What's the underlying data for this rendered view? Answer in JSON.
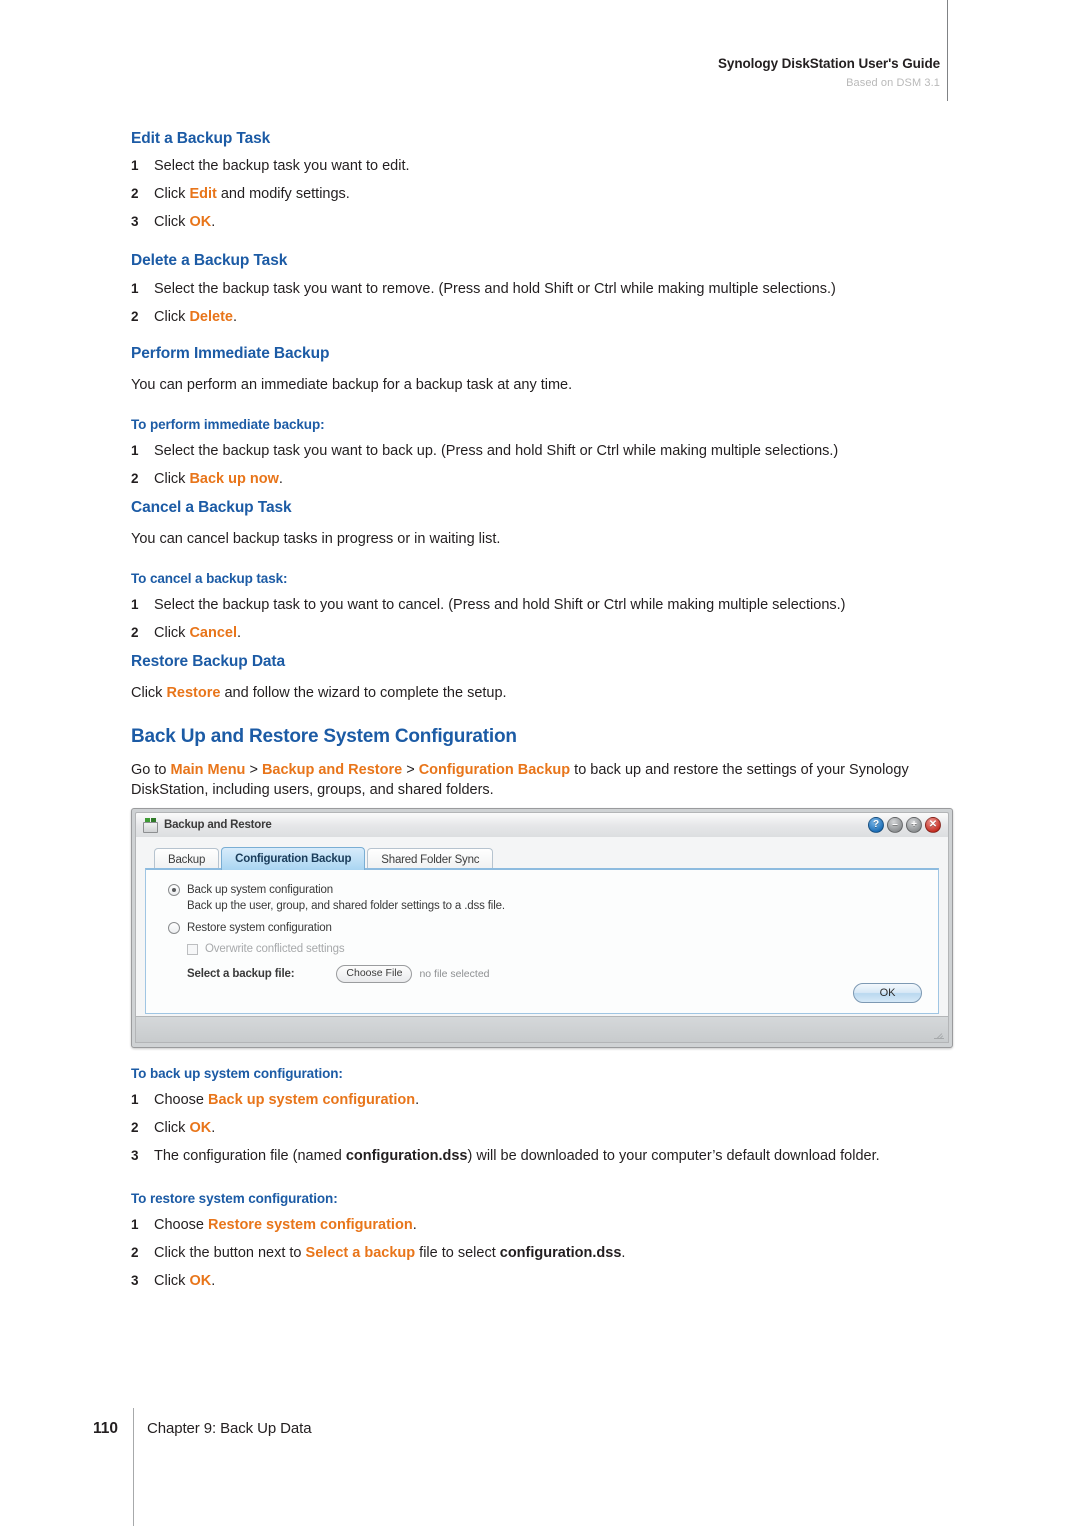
{
  "header": {
    "title": "Synology DiskStation User's Guide",
    "subtitle": "Based on DSM 3.1"
  },
  "sections": [
    {
      "id": "edit-backup-task",
      "heading": "Edit a Backup Task",
      "steps": [
        {
          "num": "1",
          "parts": [
            {
              "t": "Select the backup task you want to edit.",
              "s": "plain"
            }
          ]
        },
        {
          "num": "2",
          "parts": [
            {
              "t": "Click ",
              "s": "plain"
            },
            {
              "t": "Edit",
              "s": "em"
            },
            {
              "t": " and modify settings.",
              "s": "plain"
            }
          ]
        },
        {
          "num": "3",
          "parts": [
            {
              "t": "Click ",
              "s": "plain"
            },
            {
              "t": "OK",
              "s": "em"
            },
            {
              "t": ".",
              "s": "plain"
            }
          ]
        }
      ]
    },
    {
      "id": "delete-backup-task",
      "heading": "Delete a Backup Task",
      "steps": [
        {
          "num": "1",
          "parts": [
            {
              "t": "Select the backup task you want to remove. (Press and hold Shift or Ctrl while making multiple selections.)",
              "s": "plain"
            }
          ]
        },
        {
          "num": "2",
          "parts": [
            {
              "t": "Click ",
              "s": "plain"
            },
            {
              "t": "Delete",
              "s": "em"
            },
            {
              "t": ".",
              "s": "plain"
            }
          ]
        }
      ]
    },
    {
      "id": "perform-immediate-backup",
      "heading": "Perform Immediate Backup",
      "intro": "You can perform an immediate backup for a backup task at any time.",
      "subheading": "To perform immediate backup:",
      "steps": [
        {
          "num": "1",
          "parts": [
            {
              "t": "Select the backup task you want to back up. (Press and hold Shift or Ctrl while making multiple selections.)",
              "s": "plain"
            }
          ]
        },
        {
          "num": "2",
          "parts": [
            {
              "t": "Click ",
              "s": "plain"
            },
            {
              "t": "Back up now",
              "s": "em"
            },
            {
              "t": ".",
              "s": "plain"
            }
          ]
        }
      ]
    },
    {
      "id": "cancel-backup-task",
      "heading": "Cancel a Backup Task",
      "intro": "You can cancel backup tasks in progress or in waiting list.",
      "subheading": "To cancel a backup task:",
      "steps": [
        {
          "num": "1",
          "parts": [
            {
              "t": "Select the backup task to you want to cancel. (Press and hold Shift or Ctrl while making multiple selections.)",
              "s": "plain"
            }
          ]
        },
        {
          "num": "2",
          "parts": [
            {
              "t": "Click ",
              "s": "plain"
            },
            {
              "t": "Cancel",
              "s": "em"
            },
            {
              "t": ".",
              "s": "plain"
            }
          ]
        }
      ]
    },
    {
      "id": "restore-backup-data",
      "heading": "Restore Backup Data",
      "body": [
        {
          "t": "Click ",
          "s": "plain"
        },
        {
          "t": "Restore",
          "s": "em"
        },
        {
          "t": " and follow the wizard to complete the setup.",
          "s": "plain"
        }
      ]
    }
  ],
  "main_section": {
    "heading": "Back Up and Restore System Configuration",
    "intro": [
      {
        "t": "Go to ",
        "s": "plain"
      },
      {
        "t": "Main Menu",
        "s": "em"
      },
      {
        "t": " > ",
        "s": "plain"
      },
      {
        "t": "Backup and Restore",
        "s": "em"
      },
      {
        "t": " > ",
        "s": "plain"
      },
      {
        "t": "Configuration Backup",
        "s": "em"
      },
      {
        "t": " to back up and restore the settings of your Synology DiskStation, including users, groups, and shared folders.",
        "s": "plain"
      }
    ]
  },
  "app_window": {
    "title": "Backup and Restore",
    "window_buttons": [
      {
        "name": "help-button",
        "glyph": "?"
      },
      {
        "name": "minimize-button",
        "glyph": "–"
      },
      {
        "name": "maximize-button",
        "glyph": "+"
      },
      {
        "name": "close-button",
        "glyph": "✕"
      }
    ],
    "tabs": [
      {
        "label": "Backup",
        "active": false
      },
      {
        "label": "Configuration Backup",
        "active": true
      },
      {
        "label": "Shared Folder Sync",
        "active": false
      }
    ],
    "form": {
      "backup_radio_label": "Back up system configuration",
      "backup_radio_selected": true,
      "backup_description": "Back up the user, group, and shared folder settings to a .dss file.",
      "restore_radio_label": "Restore system configuration",
      "restore_radio_selected": false,
      "overwrite_checkbox_label": "Overwrite conflicted settings",
      "overwrite_checked": false,
      "select_file_label": "Select a backup file:",
      "choose_file_button": "Choose File",
      "file_status": "no file selected",
      "ok_button": "OK"
    }
  },
  "post_sections": [
    {
      "id": "to-back-up-system-configuration",
      "subheading": "To back up system configuration:",
      "steps": [
        {
          "num": "1",
          "parts": [
            {
              "t": "Choose ",
              "s": "plain"
            },
            {
              "t": "Back up system configuration",
              "s": "em"
            },
            {
              "t": ".",
              "s": "plain"
            }
          ]
        },
        {
          "num": "2",
          "parts": [
            {
              "t": "Click ",
              "s": "plain"
            },
            {
              "t": "OK",
              "s": "em"
            },
            {
              "t": ".",
              "s": "plain"
            }
          ]
        },
        {
          "num": "3",
          "parts": [
            {
              "t": "The configuration file (named ",
              "s": "plain"
            },
            {
              "t": "configuration.dss",
              "s": "bold"
            },
            {
              "t": ") will be downloaded to your computer’s default download folder.",
              "s": "plain"
            }
          ]
        }
      ]
    },
    {
      "id": "to-restore-system-configuration",
      "subheading": "To restore system configuration:",
      "steps": [
        {
          "num": "1",
          "parts": [
            {
              "t": "Choose ",
              "s": "plain"
            },
            {
              "t": "Restore system configuration",
              "s": "em"
            },
            {
              "t": ".",
              "s": "plain"
            }
          ]
        },
        {
          "num": "2",
          "parts": [
            {
              "t": "Click the button next to ",
              "s": "plain"
            },
            {
              "t": "Select a backup",
              "s": "em"
            },
            {
              "t": " file to select ",
              "s": "plain"
            },
            {
              "t": "configuration.dss",
              "s": "bold"
            },
            {
              "t": ".",
              "s": "plain"
            }
          ]
        },
        {
          "num": "3",
          "parts": [
            {
              "t": "Click ",
              "s": "plain"
            },
            {
              "t": "OK",
              "s": "em"
            },
            {
              "t": ".",
              "s": "plain"
            }
          ]
        }
      ]
    }
  ],
  "footer": {
    "page_number": "110",
    "chapter": "Chapter 9: Back Up Data"
  },
  "colors": {
    "heading_blue": "#1c5ba5",
    "accent_orange": "#e8751a",
    "body_text": "#231f20",
    "muted_gray": "#b9b9b9"
  }
}
